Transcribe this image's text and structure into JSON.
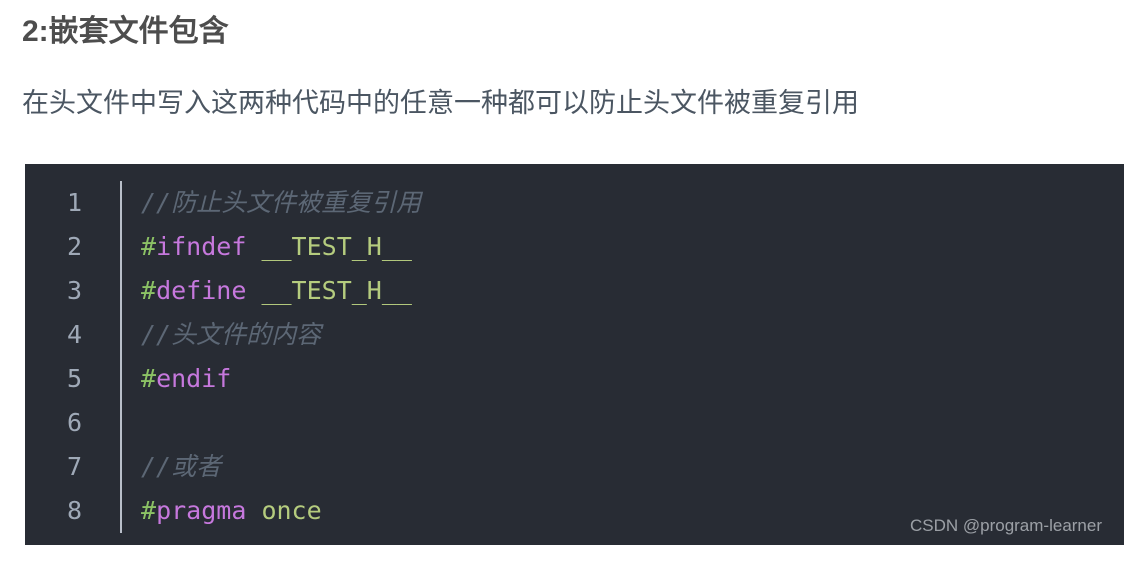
{
  "article": {
    "heading": "2:嵌套文件包含",
    "paragraph": "在头文件中写入这两种代码中的任意一种都可以防止头文件被重复引用"
  },
  "code_block": {
    "language": "c",
    "background_color": "#282c34",
    "gutter_rule_color": "#b9bfc9",
    "line_number_color": "#9fa9b7",
    "token_colors": {
      "comment": "#5c6775",
      "hash": "#8cc265",
      "directive": "#c678dd",
      "macro": "#b5cc7e"
    },
    "lines": [
      {
        "number": "1",
        "tokens": [
          {
            "text": "//防止头文件被重复引用",
            "type": "comment"
          }
        ]
      },
      {
        "number": "2",
        "tokens": [
          {
            "text": "#",
            "type": "hash"
          },
          {
            "text": "ifndef",
            "type": "directive"
          },
          {
            "text": " ",
            "type": "plain"
          },
          {
            "text": "__TEST_H__",
            "type": "macro"
          }
        ]
      },
      {
        "number": "3",
        "tokens": [
          {
            "text": "#",
            "type": "hash"
          },
          {
            "text": "define",
            "type": "directive"
          },
          {
            "text": " ",
            "type": "plain"
          },
          {
            "text": "__TEST_H__",
            "type": "macro"
          }
        ]
      },
      {
        "number": "4",
        "tokens": [
          {
            "text": "//头文件的内容",
            "type": "comment"
          }
        ]
      },
      {
        "number": "5",
        "tokens": [
          {
            "text": "#",
            "type": "hash"
          },
          {
            "text": "endif",
            "type": "directive"
          }
        ]
      },
      {
        "number": "6",
        "tokens": []
      },
      {
        "number": "7",
        "tokens": [
          {
            "text": "//或者",
            "type": "comment"
          }
        ]
      },
      {
        "number": "8",
        "tokens": [
          {
            "text": "#",
            "type": "hash"
          },
          {
            "text": "pragma",
            "type": "directive"
          },
          {
            "text": " ",
            "type": "plain"
          },
          {
            "text": "once",
            "type": "macro"
          }
        ]
      }
    ]
  },
  "watermark": {
    "text": "CSDN @program-learner"
  }
}
